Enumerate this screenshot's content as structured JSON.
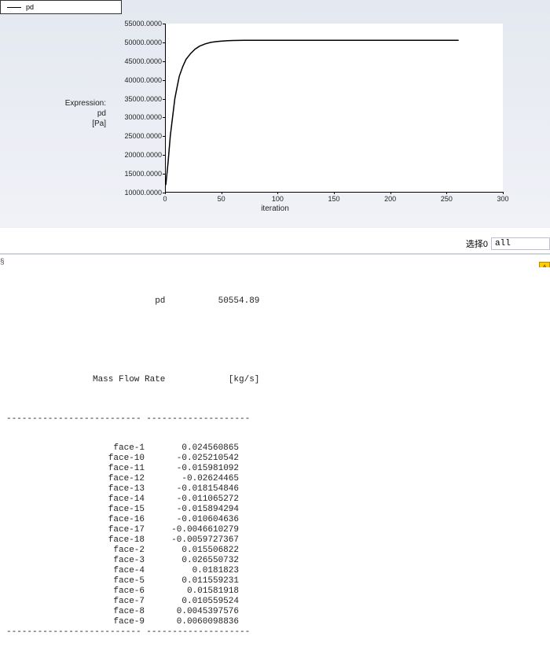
{
  "legend": {
    "series_name": "pd"
  },
  "chart_data": {
    "type": "line",
    "title": "",
    "xlabel": "iteration",
    "ylabel_block": [
      "Expression:",
      "pd",
      "[Pa]"
    ],
    "ylim": [
      10000,
      55000
    ],
    "xlim": [
      0,
      300
    ],
    "y_ticks": [
      "10000.0000",
      "15000.0000",
      "20000.0000",
      "25000.0000",
      "30000.0000",
      "35000.0000",
      "40000.0000",
      "45000.0000",
      "50000.0000",
      "55000.0000"
    ],
    "x_ticks": [
      "0",
      "50",
      "100",
      "150",
      "200",
      "250",
      "300"
    ],
    "series": [
      {
        "name": "pd",
        "x": [
          0,
          2,
          4,
          6,
          8,
          10,
          12,
          15,
          18,
          22,
          26,
          30,
          35,
          40,
          45,
          50,
          55,
          60,
          70,
          80,
          100,
          120,
          150,
          200,
          250,
          260
        ],
        "y": [
          12000,
          18000,
          25000,
          30000,
          35000,
          38000,
          41000,
          43500,
          45500,
          47000,
          48200,
          49000,
          49600,
          50000,
          50200,
          50350,
          50450,
          50500,
          50540,
          50555,
          50555,
          50555,
          50555,
          50555,
          50555,
          50555
        ]
      }
    ]
  },
  "selector": {
    "label": "选择0",
    "value": "all"
  },
  "warn_glyph": "⚠",
  "left_badge_char": "§",
  "console": {
    "header": {
      "name_label": "pd",
      "name_value": "50554.89"
    },
    "rate_header": {
      "label": "Mass Flow Rate",
      "unit": "[kg/s]"
    },
    "dash_row": "-------------------------- --------------------",
    "rows": [
      {
        "name": "face-1",
        "val": "0.024560865"
      },
      {
        "name": "face-10",
        "val": "-0.025210542"
      },
      {
        "name": "face-11",
        "val": "-0.015981092"
      },
      {
        "name": "face-12",
        "val": "-0.02624465"
      },
      {
        "name": "face-13",
        "val": "-0.018154846"
      },
      {
        "name": "face-14",
        "val": "-0.011065272"
      },
      {
        "name": "face-15",
        "val": "-0.015894294"
      },
      {
        "name": "face-16",
        "val": "-0.010604636"
      },
      {
        "name": "face-17",
        "val": "-0.0046610279"
      },
      {
        "name": "face-18",
        "val": "-0.0059727367"
      },
      {
        "name": "face-2",
        "val": "0.015506822"
      },
      {
        "name": "face-3",
        "val": "0.026550732"
      },
      {
        "name": "face-4",
        "val": "0.0181823"
      },
      {
        "name": "face-5",
        "val": "0.011559231"
      },
      {
        "name": "face-6",
        "val": "0.01581918"
      },
      {
        "name": "face-7",
        "val": "0.010559524"
      },
      {
        "name": "face-8",
        "val": "0.0045397576"
      },
      {
        "name": "face-9",
        "val": "0.0060098836"
      }
    ]
  }
}
